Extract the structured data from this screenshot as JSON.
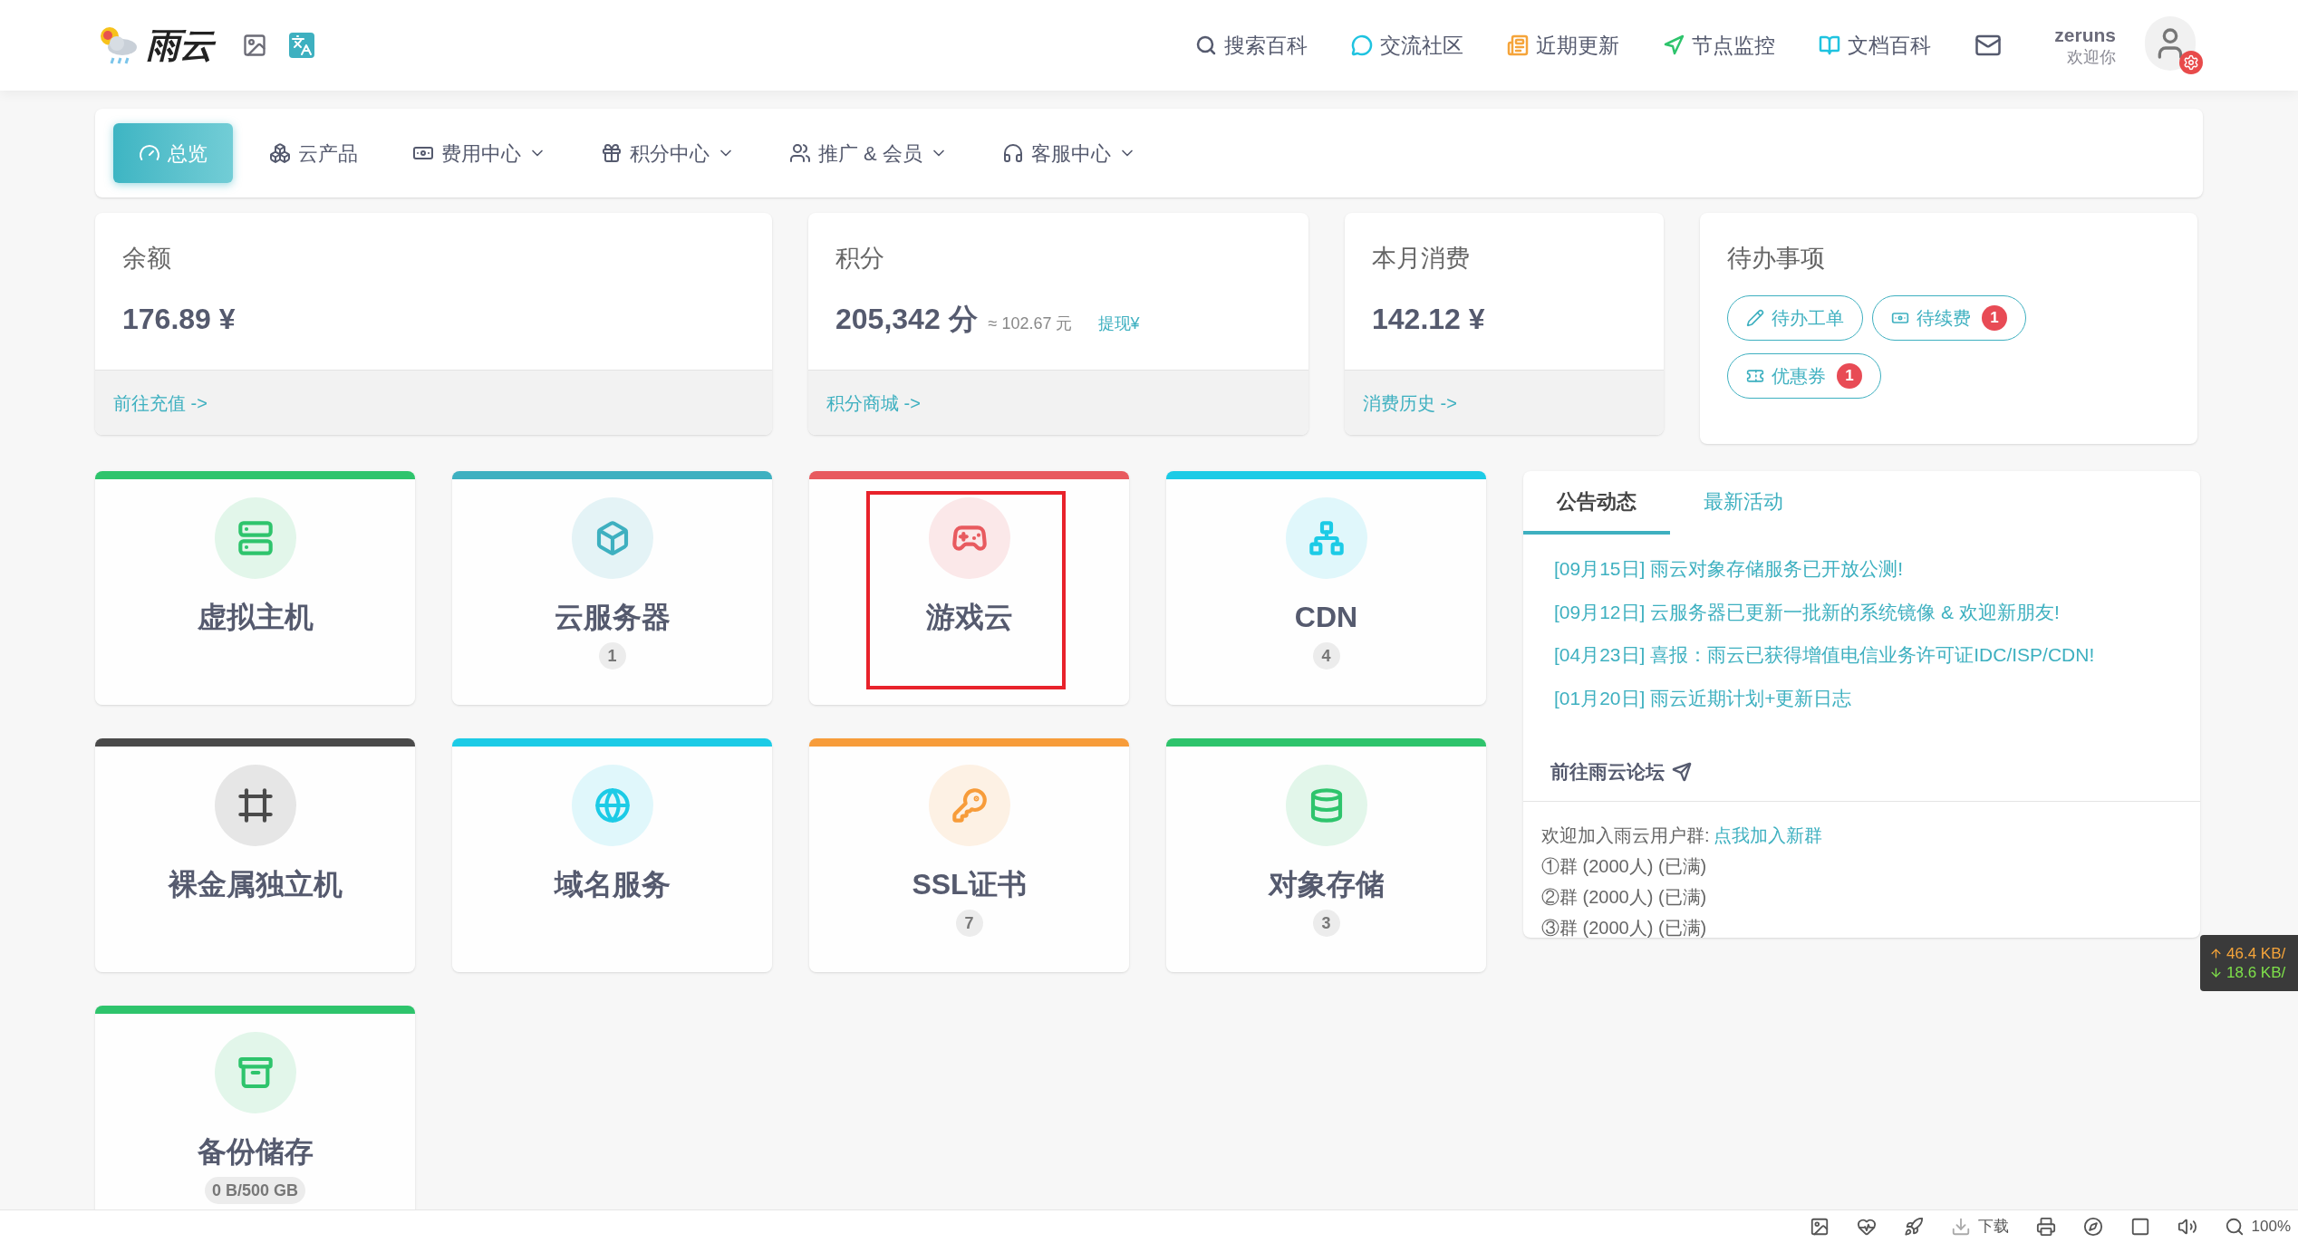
{
  "header": {
    "logo_text": "雨云",
    "links": [
      {
        "label": "搜索百科",
        "color": "#555a6e"
      },
      {
        "label": "交流社区",
        "color": "#1fc3e0"
      },
      {
        "label": "近期更新",
        "color": "#f5a43a"
      },
      {
        "label": "节点监控",
        "color": "#2ec46c"
      },
      {
        "label": "文档百科",
        "color": "#1fc3e0"
      }
    ],
    "user": {
      "name": "zeruns",
      "greeting": "欢迎你"
    }
  },
  "nav": [
    {
      "label": "总览",
      "selected": true,
      "dropdown": false
    },
    {
      "label": "云产品",
      "selected": false,
      "dropdown": false
    },
    {
      "label": "费用中心",
      "selected": false,
      "dropdown": true
    },
    {
      "label": "积分中心",
      "selected": false,
      "dropdown": true
    },
    {
      "label": "推广 & 会员",
      "selected": false,
      "dropdown": true
    },
    {
      "label": "客服中心",
      "selected": false,
      "dropdown": true
    }
  ],
  "stats": [
    {
      "title": "余额",
      "value": "176.89 ¥",
      "link": "前往充值 ->"
    },
    {
      "title": "积分",
      "value": "205,342 分",
      "note": "≈ 102.67 元",
      "action": "提现¥",
      "link": "积分商城 ->"
    },
    {
      "title": "本月消费",
      "value": "142.12 ¥",
      "link": "消费历史 ->"
    }
  ],
  "todo": {
    "title": "待办事项",
    "items": [
      {
        "label": "待办工单"
      },
      {
        "label": "待续费",
        "badge": "1"
      },
      {
        "label": "优惠券",
        "badge": "1"
      }
    ]
  },
  "products": [
    {
      "name": "虚拟主机",
      "color": "#2ec46c"
    },
    {
      "name": "云服务器",
      "color": "#3eb0c0",
      "count": "1"
    },
    {
      "name": "游戏云",
      "color": "#e85a5f",
      "highlighted": true
    },
    {
      "name": "CDN",
      "color": "#1ccbe6",
      "count": "4"
    },
    {
      "name": "裸金属独立机",
      "color": "#4a4a4a"
    },
    {
      "name": "域名服务",
      "color": "#1ccbe6"
    },
    {
      "name": "SSL证书",
      "color": "#f79c3a",
      "count": "7"
    },
    {
      "name": "对象存储",
      "color": "#2ec46c",
      "count": "3"
    },
    {
      "name": "备份储存",
      "color": "#2ec46c",
      "count": "0 B/500 GB"
    }
  ],
  "news": {
    "tabs": [
      {
        "label": "公告动态",
        "selected": true
      },
      {
        "label": "最新活动",
        "selected": false
      }
    ],
    "items": [
      "[09月15日] 雨云对象存储服务已开放公测!",
      "[09月12日] 云服务器已更新一批新的系统镜像 & 欢迎新朋友!",
      "[04月23日] 喜报：雨云已获得增值电信业务许可证IDC/ISP/CDN!",
      "[01月20日] 雨云近期计划+更新日志"
    ],
    "forum": "前往雨云论坛",
    "group_intro": "欢迎加入雨云用户群:",
    "group_link": "点我加入新群",
    "groups": [
      "①群 (2000人) (已满)",
      "②群 (2000人) (已满)",
      "③群 (2000人) (已满)"
    ]
  },
  "net_speed": {
    "up": "46.4 KB/",
    "down": "18.6 KB/"
  },
  "browser_bar": {
    "download": "下载",
    "zoom": "100%"
  }
}
